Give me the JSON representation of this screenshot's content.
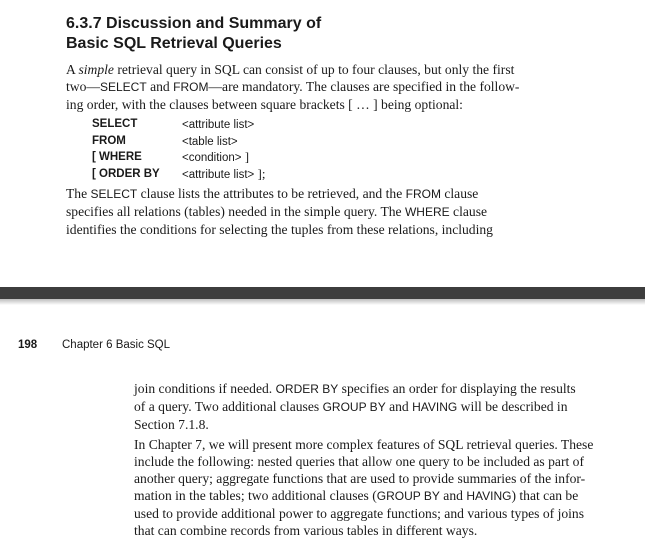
{
  "section_heading": {
    "line1": "6.3.7  Discussion and Summary of",
    "line2": "Basic SQL Retrieval Queries"
  },
  "intro": {
    "l1_a": "A ",
    "l1_em": "simple",
    "l1_b": " retrieval query in SQL can consist of up to four clauses, but only the first",
    "l2_a": "two—",
    "l2_kw1": "SELECT",
    "l2_b": " and ",
    "l2_kw2": "FROM",
    "l2_c": "—are mandatory. The clauses are specified in the follow-",
    "l3": "ing order, with the clauses between square brackets [ … ] being optional:"
  },
  "syntax": [
    {
      "keyword": "SELECT",
      "arg": "<attribute list>",
      "suffix": ""
    },
    {
      "keyword": "FROM",
      "arg": "<table list>",
      "suffix": ""
    },
    {
      "keyword": "[ WHERE",
      "arg": "<condition>",
      "suffix": " ]"
    },
    {
      "keyword": "[ ORDER BY",
      "arg": "<attribute list>",
      "suffix": " ];"
    }
  ],
  "para2": {
    "l1_a": "The ",
    "l1_kw1": "SELECT",
    "l1_b": " clause lists the attributes to be retrieved, and the ",
    "l1_kw2": "FROM",
    "l1_c": " clause",
    "l2_a": "specifies all relations (tables) needed in the simple query. The ",
    "l2_kw": "WHERE",
    "l2_b": " clause",
    "l3": "identifies the conditions for selecting the tuples from these relations, including"
  },
  "running_head": {
    "page_number": "198",
    "chapter": "Chapter 6  Basic SQL"
  },
  "para3": {
    "l1_a": "join conditions if needed. ",
    "l1_kw": "ORDER BY",
    "l1_b": " specifies an order for displaying the results",
    "l2_a": "of a query. Two additional clauses ",
    "l2_kw1": "GROUP BY",
    "l2_b": " and ",
    "l2_kw2": "HAVING",
    "l2_c": " will be described in",
    "l3": "Section 7.1.8."
  },
  "para4": {
    "l1": "In Chapter 7, we will present more complex features of SQL retrieval queries. These",
    "l2": "include the following: nested queries that allow one query to be included as part of",
    "l3": "another query; aggregate functions that are used to provide summaries of the infor-",
    "l4_a": "mation in the tables; two additional clauses (",
    "l4_kw1": "GROUP BY",
    "l4_b": " and ",
    "l4_kw2": "HAVING",
    "l4_c": ") that can be",
    "l5": "used to provide additional power to aggregate functions; and various types of joins",
    "l6": "that can combine records from various tables in different ways."
  }
}
